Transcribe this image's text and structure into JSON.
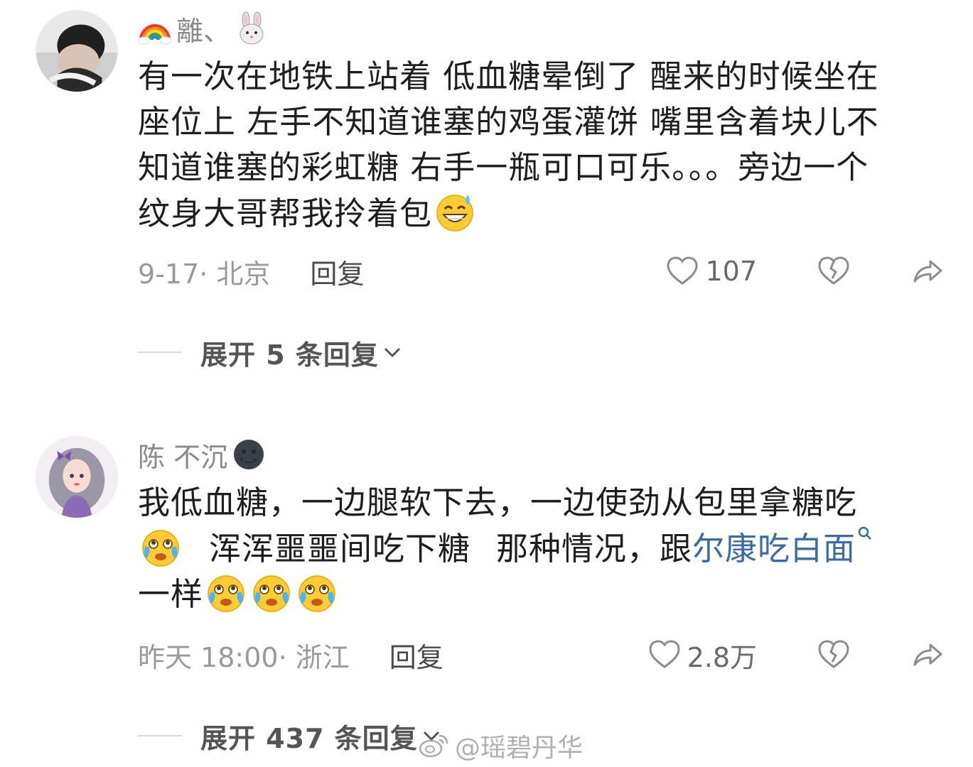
{
  "comments": [
    {
      "username": "離、",
      "content_lines": [
        "有一次在地铁上站着 低血糖晕倒了 醒来的时候坐在",
        "座位上 左手不知道谁塞的鸡蛋灌饼 嘴里含着块儿不",
        "知道谁塞的彩虹糖 右手一瓶可口可乐。。。旁边一个",
        "纹身大哥帮我拎着包"
      ],
      "meta": "9-17· 北京",
      "reply_label": "回复",
      "like_count": "107",
      "expand_label": "展开 5 条回复"
    },
    {
      "username": "陈 不沉",
      "content_line1": "我低血糖，一边腿软下去，一边使劲从包里拿糖吃",
      "content_line2_a": "浑浑噩噩间吃下糖",
      "content_line2_b": "那种情况，跟",
      "content_link": "尔康吃白面",
      "content_line3": "一样",
      "meta": "昨天 18:00· 浙江",
      "reply_label": "回复",
      "like_count": "2.8万",
      "expand_label": "展开 437 条回复"
    }
  ],
  "watermark": "@瑶碧丹华",
  "icons": {
    "username_prefix_1": "rainbow-icon",
    "username_suffix_1": "rabbit-face-icon",
    "username_suffix_2": "new-moon-face-icon",
    "comment1_end_emoji": "grinning-sweat-icon",
    "comment2_emoji": "crying-laugh-icon",
    "like": "heart-outline-icon",
    "dislike": "broken-heart-icon",
    "share": "share-arrow-icon",
    "expand": "chevron-down-icon"
  },
  "colors": {
    "text": "#1e1e1e",
    "meta": "#9a9a9a",
    "link": "#3a6aa8",
    "username": "#8a8a8a"
  }
}
